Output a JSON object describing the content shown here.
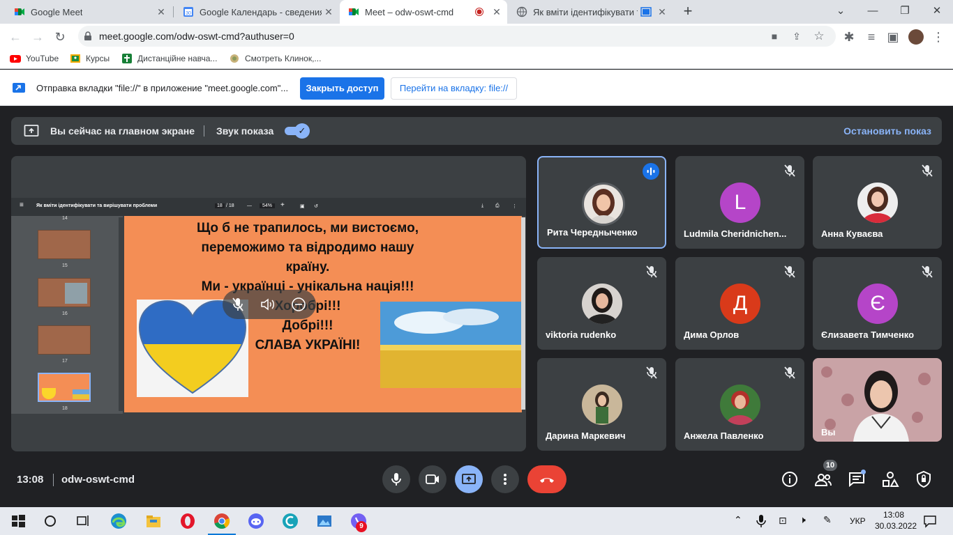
{
  "browser": {
    "tabs": [
      {
        "title": "Google Meet"
      },
      {
        "title": "Google Календарь - сведения о"
      },
      {
        "title": "Meet – odw-oswt-cmd"
      },
      {
        "title": "Як вміти ідентифікувати та"
      }
    ],
    "url": "meet.google.com/odw-oswt-cmd?authuser=0"
  },
  "bookmarks": [
    {
      "label": "YouTube"
    },
    {
      "label": "Курсы"
    },
    {
      "label": "Дистанційне навча..."
    },
    {
      "label": "Смотреть Клинок,..."
    }
  ],
  "infobar": {
    "text": "Отправка вкладки \"file://\" в приложение \"meet.google.com\"...",
    "close_access": "Закрыть доступ",
    "go_to_tab": "Перейти на вкладку: file://"
  },
  "banner": {
    "title": "Вы сейчас на главном экране",
    "sound": "Звук показа",
    "stop": "Остановить показ"
  },
  "pdf": {
    "doc_title": "Як вміти ідентифікувати та вирішувати проблеми",
    "page": "18",
    "total": "/ 18",
    "zoom": "54%",
    "thumb_numbers": [
      "14",
      "15",
      "16",
      "17",
      "18"
    ],
    "slide_lines": [
      "Що б не трапилось, ми вистоємо,",
      "переможимо та відродимо нашу",
      "країну.",
      "Ми - українці - унікальна нація!!!",
      "Хоробрі!!!",
      "Добрі!!!",
      "СЛАВА УКРАЇНІ!"
    ]
  },
  "participants": [
    {
      "name": "Рита Чередныченко",
      "speaking": true
    },
    {
      "name": "Ludmila Cheridnichen...",
      "initial": "L",
      "color": "#b545c8"
    },
    {
      "name": "Анна Куваєва"
    },
    {
      "name": "viktoria rudenko"
    },
    {
      "name": "Дима Орлов",
      "initial": "Д",
      "color": "#d93a1a"
    },
    {
      "name": "Єлизавета Тимченко",
      "initial": "Є",
      "color": "#b545c8"
    },
    {
      "name": "Дарина Маркевич"
    },
    {
      "name": "Анжела Павленко"
    },
    {
      "name": "Вы"
    }
  ],
  "meeting": {
    "time": "13:08",
    "code": "odw-oswt-cmd",
    "participants_count": "10"
  },
  "taskbar": {
    "lang": "УКР",
    "time": "13:08",
    "date": "30.03.2022",
    "viber_badge": "9"
  },
  "colors": {
    "accent": "#8ab4f8",
    "end_call": "#ea4335",
    "present": "#8ab4f8"
  }
}
